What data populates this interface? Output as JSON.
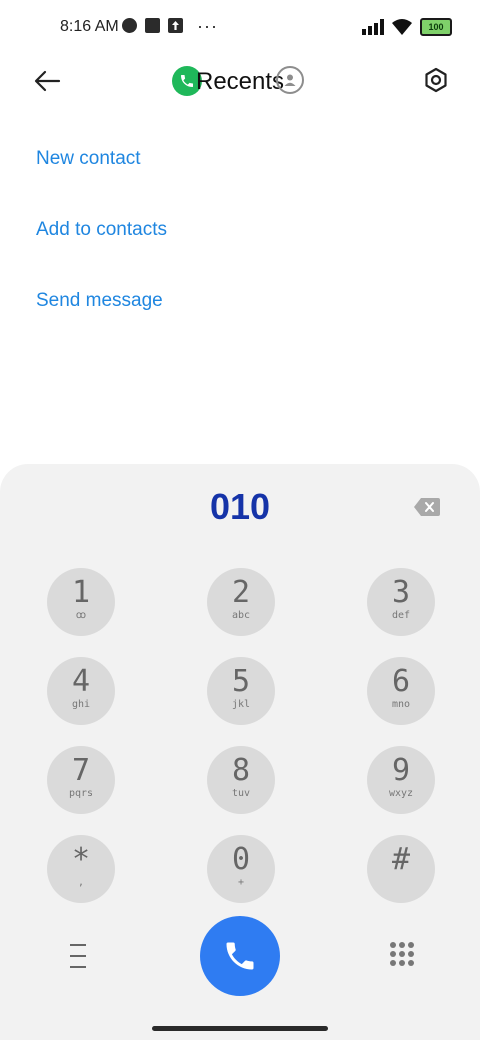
{
  "status_bar": {
    "time": "8:16 AM",
    "battery": "100",
    "icons": [
      "notification-icon",
      "app-icon",
      "upload-icon",
      "more-icon",
      "signal-icon",
      "wifi-icon",
      "battery-icon"
    ]
  },
  "app_bar": {
    "title": "Recents",
    "icons": [
      "back-arrow-icon",
      "phone-icon",
      "person-icon",
      "settings-icon"
    ]
  },
  "actions": [
    {
      "label": "New contact"
    },
    {
      "label": "Add to contacts"
    },
    {
      "label": "Send message"
    }
  ],
  "dialer": {
    "number": "010",
    "keys": [
      {
        "digit": "1",
        "letters": "ꝏ"
      },
      {
        "digit": "2",
        "letters": "abc"
      },
      {
        "digit": "3",
        "letters": "def"
      },
      {
        "digit": "4",
        "letters": "ghi"
      },
      {
        "digit": "5",
        "letters": "jkl"
      },
      {
        "digit": "6",
        "letters": "mno"
      },
      {
        "digit": "7",
        "letters": "pqrs"
      },
      {
        "digit": "8",
        "letters": "tuv"
      },
      {
        "digit": "9",
        "letters": "wxyz"
      },
      {
        "digit": "*",
        "letters": ","
      },
      {
        "digit": "0",
        "letters": "+"
      },
      {
        "digit": "#",
        "letters": ""
      }
    ]
  },
  "colors": {
    "accent": "#1f86e0",
    "number": "#1533a8",
    "call_button": "#2f7cf2",
    "dialer_bg": "#f2f2f2",
    "key_bg": "#dadada"
  }
}
